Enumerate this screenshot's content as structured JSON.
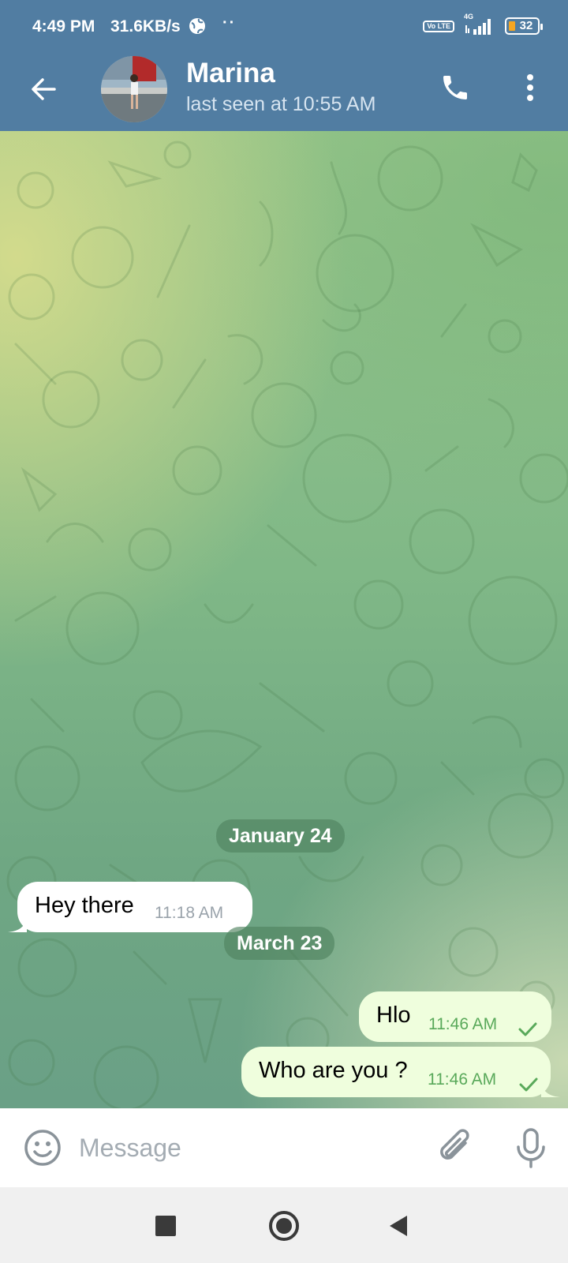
{
  "status_bar": {
    "time": "4:49 PM",
    "network_speed": "31.6KB/s",
    "dots": "··",
    "volte": "Vo LTE",
    "network_type": "4G",
    "battery": "32"
  },
  "header": {
    "contact_name": "Marina",
    "last_seen": "last seen at 10:55 AM"
  },
  "messages": [
    {
      "type": "date",
      "label": "January 24"
    },
    {
      "type": "incoming",
      "text": "Hey there",
      "time": "11:18 AM"
    },
    {
      "type": "date",
      "label": "March 23"
    },
    {
      "type": "outgoing",
      "text": "Hlo",
      "time": "11:46 AM",
      "status": "sent"
    },
    {
      "type": "outgoing",
      "text": "Who are you ?",
      "time": "11:46 AM",
      "status": "sent"
    }
  ],
  "input": {
    "placeholder": "Message",
    "value": ""
  },
  "icons": {
    "back": "arrow-left-icon",
    "call": "phone-icon",
    "menu": "more-vertical-icon",
    "emoji": "emoji-icon",
    "attach": "paperclip-icon",
    "mic": "microphone-icon"
  },
  "colors": {
    "header": "#517da2",
    "incoming_bubble": "#ffffff",
    "outgoing_bubble": "#effedd",
    "outgoing_time": "#59a95a"
  }
}
